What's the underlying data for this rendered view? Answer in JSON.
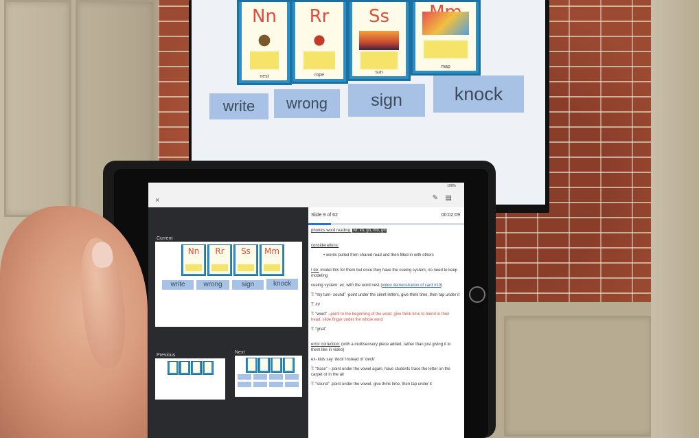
{
  "tv": {
    "cards": [
      {
        "letter": "Nn",
        "word": "nest"
      },
      {
        "letter": "Rr",
        "word": "rope"
      },
      {
        "letter": "Ss",
        "word": "sun"
      },
      {
        "letter": "Mm",
        "word": "map"
      }
    ],
    "words": [
      "write",
      "wrong",
      "sign",
      "knock"
    ]
  },
  "ipad": {
    "status": "100%",
    "close_icon": "×",
    "pen_icon": "✎",
    "comment_icon": "▤",
    "current_label": "Current",
    "previous_label": "Previous",
    "next_label": "Next",
    "current_slide": {
      "cards": [
        "Nn",
        "Rr",
        "Ss",
        "Mm"
      ],
      "words": [
        "write",
        "wrong",
        "sign",
        "knock"
      ]
    },
    "slide_count": "Slide 9 of 62",
    "timer": "00:02:09",
    "progress": 0.145,
    "notes": {
      "heading": "phonics word reading:",
      "heading_tag": "wr, kn, gn, mb, gh",
      "considerations_label": "considerations:",
      "bullet": "• words pulled from shared read and then filled in with others",
      "ido_label": "I do:",
      "ido_text": " model this for them but once they have the cueing system, no need to keep modeling",
      "cueing_text": "cueing system: ex. with the word nest (",
      "cueing_link": "video demonstration of card #10",
      "cueing_end": ")",
      "t1": "T: “my turn- sound” -point under the silent letters, give think time, then tap under it",
      "t2": "T: /n/",
      "t3a": "T: “word” –",
      "t3b": "point to the beginning of the word, give think time to blend in their head, slide finger under the whole word",
      "t4": "T: “gnat”",
      "error_label": "error correction:",
      "error_text": " (with a multisensory piece added, rather than just giving it to them like in video)",
      "ex": "ex- kids say ‘dock’ instead of ‘deck’",
      "t5": "T: “trace” – point under the vowel again, have students trace the letter on the carpet or in the air",
      "t6": "T: “sound” -point under the vowel, give think time, then tap under it"
    }
  }
}
